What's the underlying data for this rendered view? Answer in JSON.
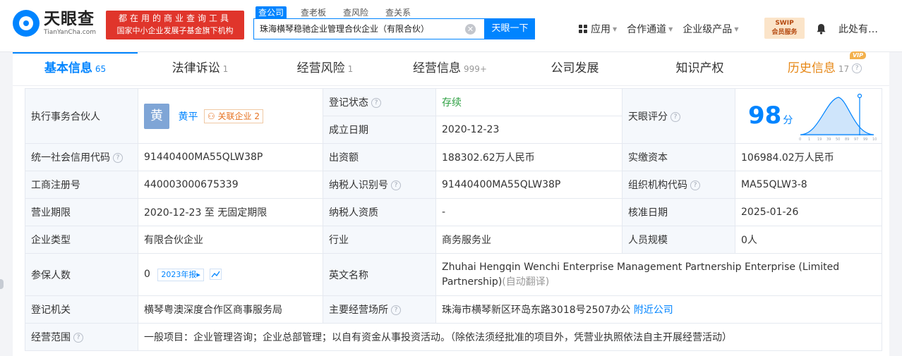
{
  "header": {
    "logo_cn": "天眼查",
    "logo_en": "TianYanCha.com",
    "slogan_line1": "都在用的商业查询工具",
    "slogan_line2": "国家中小企业发展子基金旗下机构",
    "search_tabs": [
      "查公司",
      "查老板",
      "查风险",
      "查关系"
    ],
    "search_value": "珠海横琴稳驰企业管理合伙企业（有限合伙）",
    "search_button": "天眼一下",
    "nav": [
      "应用",
      "合作通道",
      "企业级产品"
    ],
    "swip_line1": "SWIP",
    "swip_line2": "会员服务",
    "user": "此处有…"
  },
  "tabs": [
    {
      "label": "基本信息",
      "count": "65"
    },
    {
      "label": "法律诉讼",
      "count": "1"
    },
    {
      "label": "经营风险",
      "count": "1"
    },
    {
      "label": "经营信息",
      "count": "999+"
    },
    {
      "label": "公司发展",
      "count": ""
    },
    {
      "label": "知识产权",
      "count": ""
    },
    {
      "label": "历史信息",
      "count": "17",
      "badge": "VIP"
    }
  ],
  "info": {
    "partner_label": "执行事务合伙人",
    "partner_avatar": "黄",
    "partner_name": "黄平",
    "related_label": "关联企业",
    "related_count": "2",
    "status_label": "登记状态",
    "status_value": "存续",
    "found_label": "成立日期",
    "found_value": "2020-12-23",
    "score_label": "天眼评分",
    "score_value": "98",
    "score_unit": "分",
    "score_ticks": [
      "0",
      "1",
      "19",
      "39",
      "50",
      "89",
      "97",
      "99",
      "100"
    ],
    "credit_label": "统一社会信用代码",
    "credit_value": "91440400MA55QLW38P",
    "capital_label": "出资额",
    "capital_value": "188302.62万人民币",
    "paid_label": "实缴资本",
    "paid_value": "106984.02万人民币",
    "reg_label": "工商注册号",
    "reg_value": "440003000675339",
    "tax_label": "纳税人识别号",
    "tax_value": "91440400MA55QLW38P",
    "org_label": "组织机构代码",
    "org_value": "MA55QLW3-8",
    "term_label": "营业期限",
    "term_value": "2020-12-23 至 无固定期限",
    "taxq_label": "纳税人资质",
    "taxq_value": "-",
    "approve_label": "核准日期",
    "approve_value": "2025-01-26",
    "type_label": "企业类型",
    "type_value": "有限合伙企业",
    "industry_label": "行业",
    "industry_value": "商务服务业",
    "staff_label": "人员规模",
    "staff_value": "0人",
    "insured_label": "参保人数",
    "insured_value": "0",
    "insured_tag": "2023年报",
    "english_label": "英文名称",
    "english_value": "Zhuhai Hengqin Wenchi Enterprise Management Partnership Enterprise (Limited Partnership)",
    "english_note": "(自动翻译)",
    "authority_label": "登记机关",
    "authority_value": "横琴粤澳深度合作区商事服务局",
    "address_label": "主要经营场所",
    "address_value": "珠海市横琴新区环岛东路3018号2507办公",
    "nearby_label": "附近公司",
    "scope_label": "经营范围",
    "scope_value": "一般项目：企业管理咨询；企业总部管理；以自有资金从事投资活动。（除依法须经批准的项目外，凭营业执照依法自主开展经营活动）"
  }
}
